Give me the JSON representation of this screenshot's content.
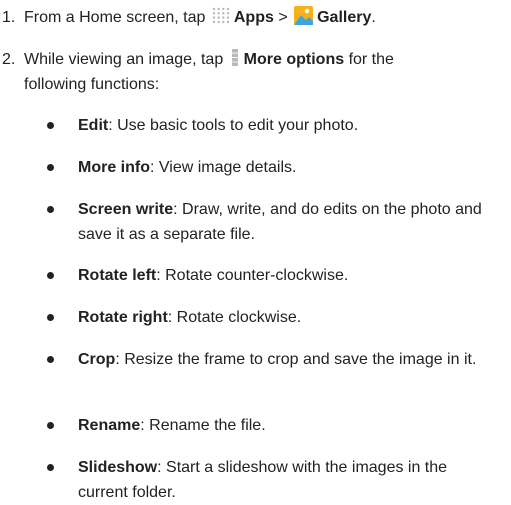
{
  "step1": {
    "number": "1.",
    "prefix": "From a Home screen, tap",
    "apps_icon": "apps-grid-icon",
    "apps_label": "Apps",
    "separator": ">",
    "gallery_icon": "gallery-icon",
    "gallery_label": "Gallery",
    "suffix": "."
  },
  "step2": {
    "number": "2.",
    "prefix": "While viewing an image, tap",
    "more_icon": "more-options-icon",
    "more_label": "More options",
    "suffix_line1": "for the",
    "suffix_line2": "following functions:"
  },
  "bullets": [
    {
      "term": "Edit",
      "desc": ": Use basic tools to edit your photo."
    },
    {
      "term": "More info",
      "desc": ": View image details."
    },
    {
      "term": "Screen write",
      "desc": ": Draw, write, and do edits on the photo and save it as a separate file."
    },
    {
      "term": "Rotate left",
      "desc": ": Rotate counter-clockwise."
    },
    {
      "term": "Rotate right",
      "desc": ": Rotate clockwise."
    },
    {
      "term": "Crop",
      "desc": ": Resize the frame to crop and save the image in it."
    },
    {
      "term": "Rename",
      "desc": ": Rename the file."
    },
    {
      "term": "Slideshow",
      "desc": ": Start a slideshow with the images in the current folder."
    }
  ],
  "colors": {
    "text": "#222222",
    "apps_dots": "#b8b8b8",
    "gallery_yellow": "#f6b317",
    "gallery_blue": "#41a3e0"
  }
}
